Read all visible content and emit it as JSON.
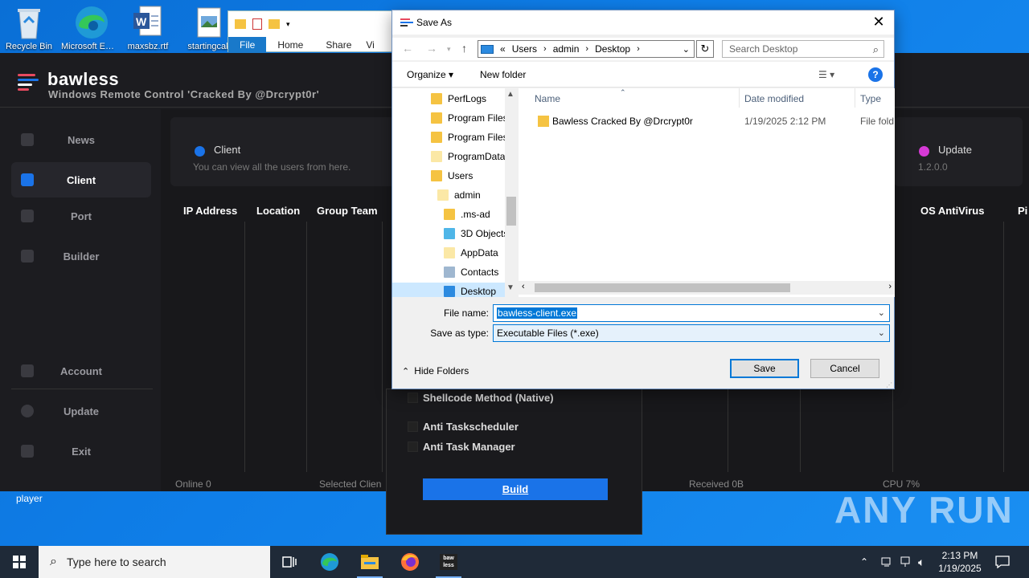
{
  "desktop": {
    "icons": [
      {
        "label": "Recycle Bin"
      },
      {
        "label": "Microsoft Edge"
      },
      {
        "label": "maxsbz.rtf"
      },
      {
        "label": "startingcak"
      }
    ],
    "player_label": "player",
    "watermark": "ANY RUN"
  },
  "explorer_bg": {
    "tabs": [
      "File",
      "Home",
      "Share",
      "Vi"
    ]
  },
  "bawless": {
    "title": "bawless",
    "subtitle": "Windows Remote Control 'Cracked By @Drcrypt0r'",
    "nav": [
      {
        "label": "News"
      },
      {
        "label": "Client"
      },
      {
        "label": "Port"
      },
      {
        "label": "Builder"
      },
      {
        "label": "Account"
      },
      {
        "label": "Update"
      },
      {
        "label": "Exit"
      }
    ],
    "client_card": {
      "title": "Client",
      "desc": "You can view all the users from here."
    },
    "update_card": {
      "title": "Update",
      "version": "1.2.0.0"
    },
    "columns": [
      "IP Address",
      "Location",
      "Group Team",
      "OS AntiVirus",
      "Pi"
    ],
    "status": {
      "online": "Online 0",
      "selected": "Selected Clien",
      "received": "Received  0B",
      "cpu": "CPU 7%"
    }
  },
  "builder": {
    "options": [
      "Shellcode Method (Native)",
      "Anti Taskscheduler",
      "Anti Task Manager"
    ],
    "build_label": "Build"
  },
  "dialog": {
    "title": "Save As",
    "breadcrumb": [
      "«",
      "Users",
      "admin",
      "Desktop"
    ],
    "search_placeholder": "Search Desktop",
    "organize": "Organize",
    "new_folder": "New folder",
    "tree": [
      "PerfLogs",
      "Program Files",
      "Program Files",
      "ProgramData",
      "Users",
      "admin",
      ".ms-ad",
      "3D Objects",
      "AppData",
      "Contacts",
      "Desktop"
    ],
    "columns": {
      "name": "Name",
      "date": "Date modified",
      "type": "Type"
    },
    "files": [
      {
        "name": "Bawless Cracked By @Drcrypt0r",
        "date": "1/19/2025 2:12 PM",
        "type": "File fold"
      }
    ],
    "file_name_label": "File name:",
    "file_name_value": "bawless-client.exe",
    "save_type_label": "Save as type:",
    "save_type_value": "Executable Files (*.exe)",
    "hide_folders": "Hide Folders",
    "save": "Save",
    "cancel": "Cancel"
  },
  "taskbar": {
    "search_placeholder": "Type here to search",
    "time": "2:13 PM",
    "date": "1/19/2025"
  }
}
